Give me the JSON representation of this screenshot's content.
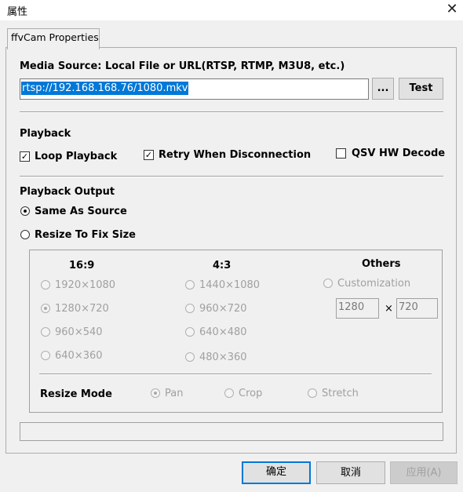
{
  "window": {
    "title": "属性",
    "close_glyph": "✕"
  },
  "tab": {
    "label": "ffvCam Properties"
  },
  "media": {
    "label": "Media Source: Local File or URL(RTSP, RTMP, M3U8, etc.)",
    "url": "rtsp://192.168.168.76/1080.mkv",
    "browse_label": "...",
    "test_label": "Test"
  },
  "playback": {
    "heading": "Playback",
    "loop": {
      "label": "Loop Playback",
      "checked": true,
      "mark": "✓"
    },
    "retry": {
      "label": "Retry When Disconnection",
      "checked": true,
      "mark": "✓"
    },
    "qsv": {
      "label": "QSV HW Decode",
      "checked": false
    }
  },
  "output": {
    "heading": "Playback Output",
    "same_as_source": {
      "label": "Same As Source",
      "selected": true
    },
    "resize": {
      "label": "Resize To Fix Size",
      "selected": false
    }
  },
  "resize_group": {
    "col_169": {
      "heading": "16:9",
      "options": [
        "1920×1080",
        "1280×720",
        "960×540",
        "640×360"
      ],
      "selected": "1280×720"
    },
    "col_43": {
      "heading": "4:3",
      "options": [
        "1440×1080",
        "960×720",
        "640×480",
        "480×360"
      ]
    },
    "col_others": {
      "heading": "Others",
      "custom_label": "Customization",
      "width": "1280",
      "times": "×",
      "height": "720"
    },
    "mode": {
      "label": "Resize Mode",
      "options": [
        "Pan",
        "Crop",
        "Stretch"
      ],
      "selected": "Pan"
    }
  },
  "status_text": "",
  "buttons": {
    "ok": "确定",
    "cancel": "取消",
    "apply": "应用(A)"
  },
  "colors": {
    "selection": "#0078d7",
    "disabled_text": "#a0a0a0",
    "window_bg": "#f0f0f0"
  }
}
